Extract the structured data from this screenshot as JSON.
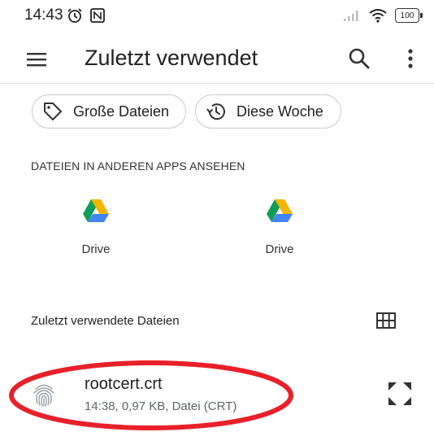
{
  "status_bar": {
    "time": "14:43",
    "battery": "100",
    "icons": [
      "alarm-icon",
      "nfc-icon",
      "signal-icon",
      "wifi-icon",
      "battery-icon"
    ]
  },
  "toolbar": {
    "title": "Zuletzt verwendet",
    "icons": [
      "menu-icon",
      "search-icon",
      "more-vert-icon"
    ]
  },
  "chips": [
    {
      "label": "Große Dateien",
      "icon": "tag-icon"
    },
    {
      "label": "Diese Woche",
      "icon": "history-icon"
    }
  ],
  "apps_section": {
    "header": "DATEIEN IN ANDEREN APPS ANSEHEN",
    "apps": [
      {
        "label": "Drive",
        "icon": "google-drive-icon"
      },
      {
        "label": "Drive",
        "icon": "google-drive-icon"
      }
    ]
  },
  "recent_section": {
    "header": "Zuletzt verwendete Dateien",
    "view_toggle_icon": "grid-view-icon"
  },
  "files": [
    {
      "name": "rootcert.crt",
      "meta": "14:38, 0,97 KB, Datei (CRT)",
      "icon": "fingerprint-icon"
    }
  ],
  "colors": {
    "highlight_ellipse": "#e8202a",
    "drive_green": "#0f9d58",
    "drive_yellow": "#f4b400",
    "drive_blue": "#4285f4"
  }
}
